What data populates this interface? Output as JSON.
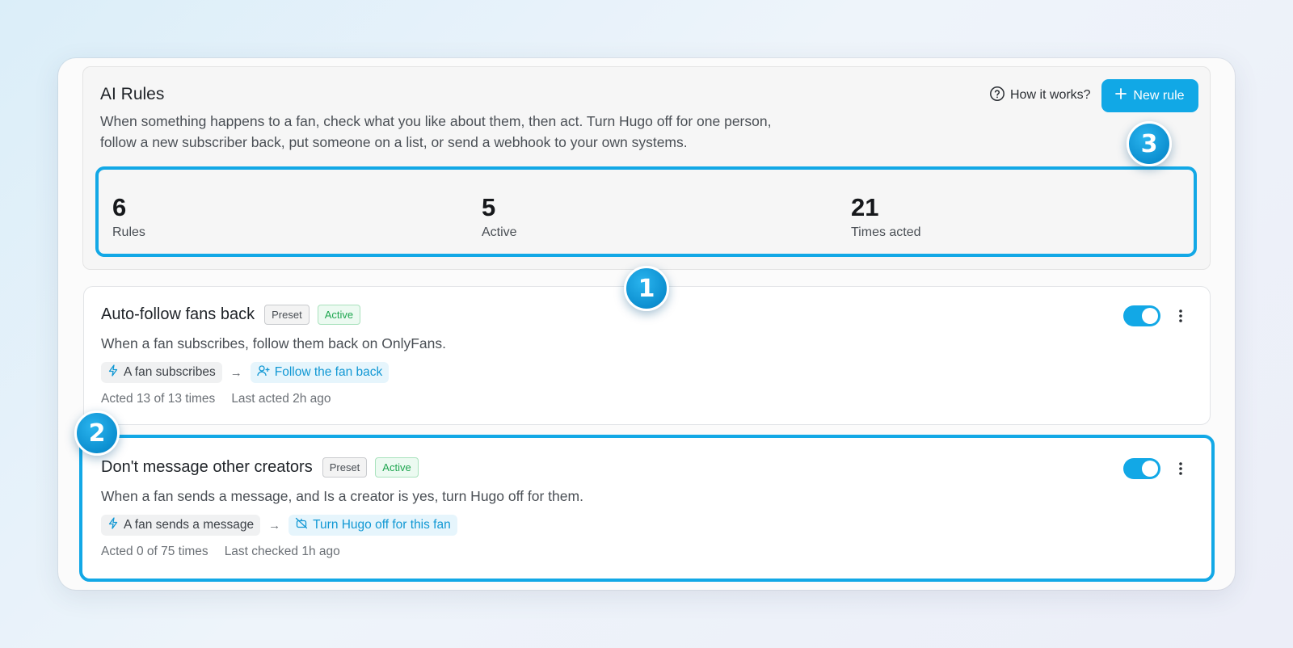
{
  "header": {
    "title": "AI Rules",
    "description": "When something happens to a fan, check what you like about them, then act. Turn Hugo off for one person, follow a new subscriber back, put someone on a list, or send a webhook to your own systems.",
    "how_it_works": "How it works?",
    "new_rule": "New rule"
  },
  "stats": [
    {
      "value": "6",
      "label": "Rules"
    },
    {
      "value": "5",
      "label": "Active"
    },
    {
      "value": "21",
      "label": "Times acted"
    }
  ],
  "rules": [
    {
      "title": "Auto-follow fans back",
      "preset": "Preset",
      "status": "Active",
      "description": "When a fan subscribes, follow them back on OnlyFans.",
      "trigger": "A fan subscribes",
      "action": "Follow the fan back",
      "acted": "Acted 13 of 13 times",
      "last": "Last acted 2h ago",
      "enabled": true
    },
    {
      "title": "Don't message other creators",
      "preset": "Preset",
      "status": "Active",
      "description": "When a fan sends a message, and Is a creator is yes, turn Hugo off for them.",
      "trigger": "A fan sends a message",
      "action": "Turn Hugo off for this fan",
      "acted": "Acted 0 of 75 times",
      "last": "Last checked 1h ago",
      "enabled": true
    }
  ],
  "callouts": {
    "one": "1",
    "two": "2",
    "three": "3"
  },
  "colors": {
    "accent": "#12a8e6",
    "active_green": "#1fa650"
  },
  "icons": {
    "help": "help-circle-icon",
    "plus": "plus-icon",
    "trigger": "bolt-icon",
    "follow": "user-plus-icon",
    "hugo_off": "bot-off-icon",
    "menu": "more-vertical-icon"
  }
}
